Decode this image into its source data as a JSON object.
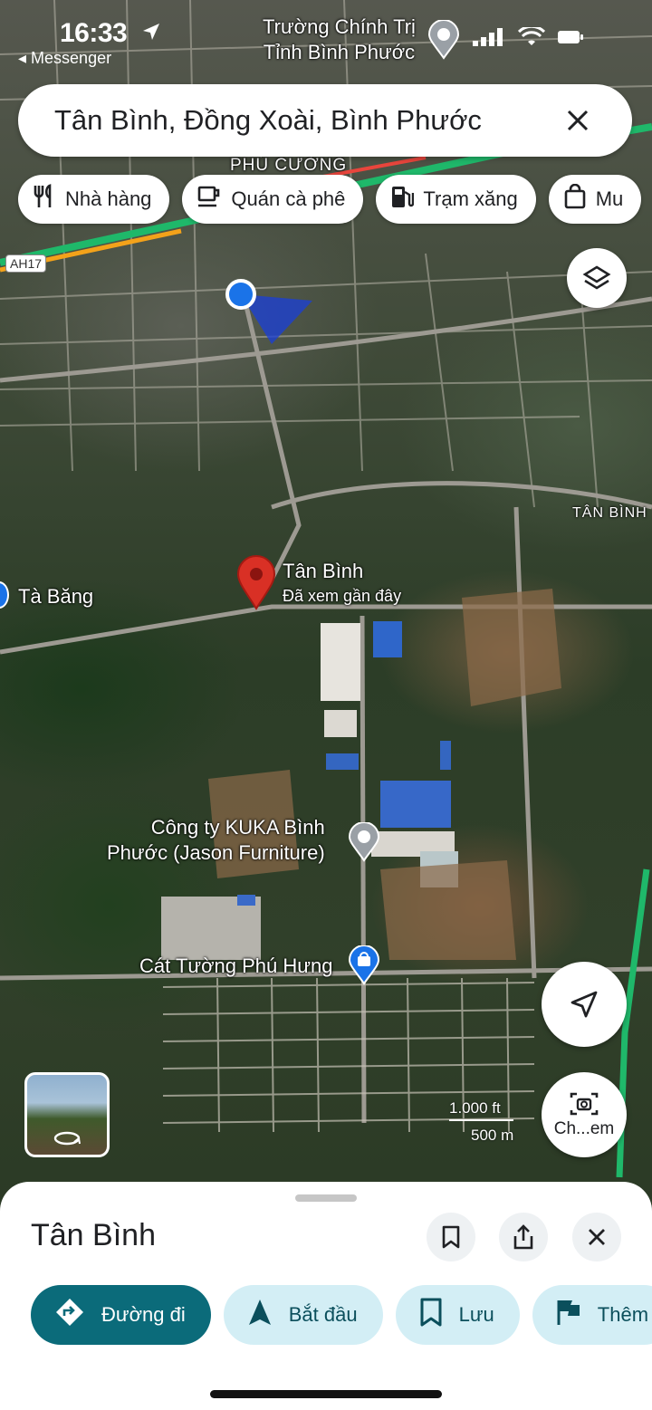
{
  "status_bar": {
    "time": "16:33",
    "back_app": "◂ Messenger"
  },
  "search": {
    "query": "Tân Bình, Đồng Xoài, Bình Phước"
  },
  "chips": [
    {
      "label": "Nhà hàng",
      "icon": "restaurant-icon"
    },
    {
      "label": "Quán cà phê",
      "icon": "coffee-icon"
    },
    {
      "label": "Trạm xăng",
      "icon": "gas-station-icon"
    },
    {
      "label": "Mu",
      "icon": "shopping-bag-icon"
    }
  ],
  "map": {
    "labels": {
      "truong_chinh_tri": "Trường Chính Trị\nTỉnh Bình Phước",
      "phu_cuong": "PHÚ CƯỜNG",
      "ah17": "AH17",
      "tan_binh_area": "TÂN BÌNH",
      "ta_bang": "Tà Băng",
      "pin_title": "Tân Bình",
      "pin_sub": "Đã xem gần đây",
      "kuka": "Công ty KUKA Bình\nPhước (Jason Furniture)",
      "cat_tuong": "Cát Tường Phú Hưng",
      "scale_ft": "1.000 ft",
      "scale_m": "500 m",
      "camera_label": "Ch...em"
    },
    "colors": {
      "pin": "#d93025",
      "my_location": "#1a73e8",
      "traffic_green": "#1fb86a",
      "traffic_orange": "#f3a21a",
      "traffic_red": "#e8453c"
    }
  },
  "sheet": {
    "title": "Tân Bình",
    "actions": [
      {
        "label": "Đường đi",
        "icon": "directions-icon"
      },
      {
        "label": "Bắt đầu",
        "icon": "navigation-arrow-icon"
      },
      {
        "label": "Lưu",
        "icon": "bookmark-icon"
      },
      {
        "label": "Thêm",
        "icon": "flag-icon"
      }
    ]
  }
}
